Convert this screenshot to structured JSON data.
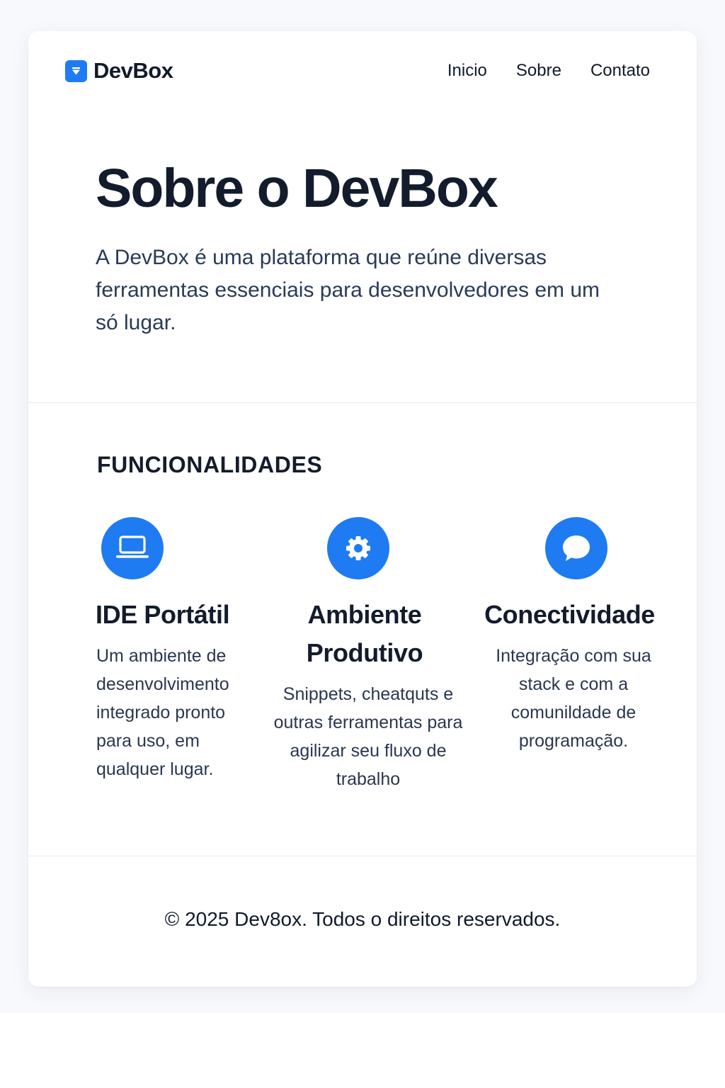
{
  "brand": {
    "name": "DevBox",
    "accent_color": "#1f7bf2",
    "logo_icon": "devbox-logo-icon"
  },
  "nav": {
    "items": [
      {
        "label": "Inicio"
      },
      {
        "label": "Sobre"
      },
      {
        "label": "Contato"
      }
    ]
  },
  "hero": {
    "title": "Sobre o DevBox",
    "description": "A DevBox é uma plataforma que reúne diversas ferramentas essenciais para desenvolvedores em um só lugar."
  },
  "features": {
    "heading": "FUNCIONALIDADES",
    "items": [
      {
        "icon": "laptop-icon",
        "title": "IDE Portátil",
        "description": "Um ambiente de desenvolvimento integrado pronto para uso, em qualquer lugar."
      },
      {
        "icon": "gear-icon",
        "title": "Ambiente Produtivo",
        "description": "Snippets, cheatquts e outras ferramentas para agilizar seu fluxo de trabalho"
      },
      {
        "icon": "chat-bubble-icon",
        "title": "Conectividade",
        "description": "Integração com sua stack e com a comunildade de programação."
      }
    ]
  },
  "footer": {
    "text": "© 2025 Dev8ox. Todos o direitos reservados."
  }
}
